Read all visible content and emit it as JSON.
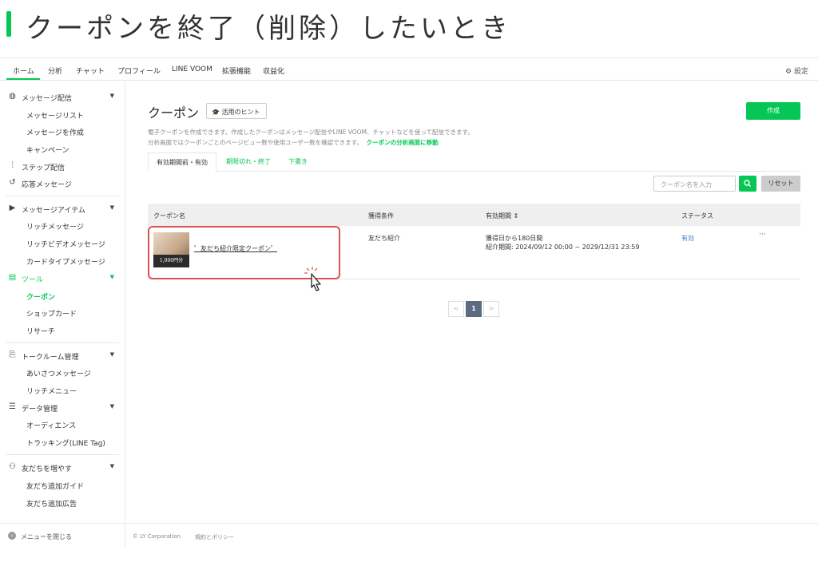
{
  "banner": {
    "title": "クーポンを終了（削除）したいとき"
  },
  "colors": {
    "accent": "#06c755",
    "highlight": "#d9534f",
    "link": "#3b7fd6"
  },
  "topnav": {
    "tabs": [
      "ホーム",
      "分析",
      "チャット",
      "プロフィール",
      "LINE VOOM",
      "拡張機能",
      "収益化"
    ],
    "active": "ホーム",
    "settings": "設定"
  },
  "sidebar": {
    "sections": [
      {
        "label": "メッセージ配信",
        "icon": "broadcast-icon",
        "items": [
          "メッセージリスト",
          "メッセージを作成",
          "キャンペーン"
        ]
      },
      {
        "label": "ステップ配信",
        "icon": "step-icon"
      },
      {
        "label": "応答メッセージ",
        "icon": "reply-icon"
      },
      {
        "label": "メッセージアイテム",
        "icon": "message-item-icon",
        "items": [
          "リッチメッセージ",
          "リッチビデオメッセージ",
          "カードタイプメッセージ"
        ]
      },
      {
        "label": "ツール",
        "icon": "tool-icon",
        "items": [
          "クーポン",
          "ショップカード",
          "リサーチ"
        ],
        "active_item": "クーポン"
      },
      {
        "label": "トークルーム管理",
        "icon": "talkroom-icon",
        "items": [
          "あいさつメッセージ",
          "リッチメニュー"
        ]
      },
      {
        "label": "データ管理",
        "icon": "database-icon",
        "items": [
          "オーディエンス",
          "トラッキング(LINE Tag)"
        ]
      },
      {
        "label": "友だちを増やす",
        "icon": "add-friend-icon",
        "items": [
          "友だち追加ガイド",
          "友だち追加広告"
        ]
      }
    ],
    "close_menu": "メニューを閉じる"
  },
  "main": {
    "title": "クーポン",
    "hint_button": "活用のヒント",
    "create_button": "作成",
    "description_line1": "電子クーポンを作成できます。作成したクーポンはメッセージ配信やLINE VOOM、チャットなどを使って配信できます。",
    "description_line2": "分析画面ではクーポンごとのページビュー数や使用ユーザー数を確認できます。",
    "description_link": "クーポンの分析画面に移動",
    "tabs": [
      "有効期間前・有効",
      "期限切れ・終了",
      "下書き"
    ],
    "search_placeholder": "クーポン名を入力",
    "reset_button": "リセット",
    "table": {
      "headers": [
        "クーポン名",
        "獲得条件",
        "有効期間",
        "ステータス"
      ],
      "sort_icon": "⇕",
      "rows": [
        {
          "thumbnail_text": "1,000円分",
          "name": "゜友だち紹介限定クーポン゜",
          "condition": "友だち紹介",
          "period_line1": "獲得日から180日間",
          "period_line2": "紹介期間: 2024/09/12 00:00 ~ 2029/12/31 23:59",
          "status": "有効",
          "more": "···"
        }
      ]
    },
    "pagination": {
      "prev": "<",
      "current": "1",
      "next": ">"
    }
  },
  "footer": {
    "copyright": "© LY Corporation",
    "policy": "規約とポリシー"
  }
}
